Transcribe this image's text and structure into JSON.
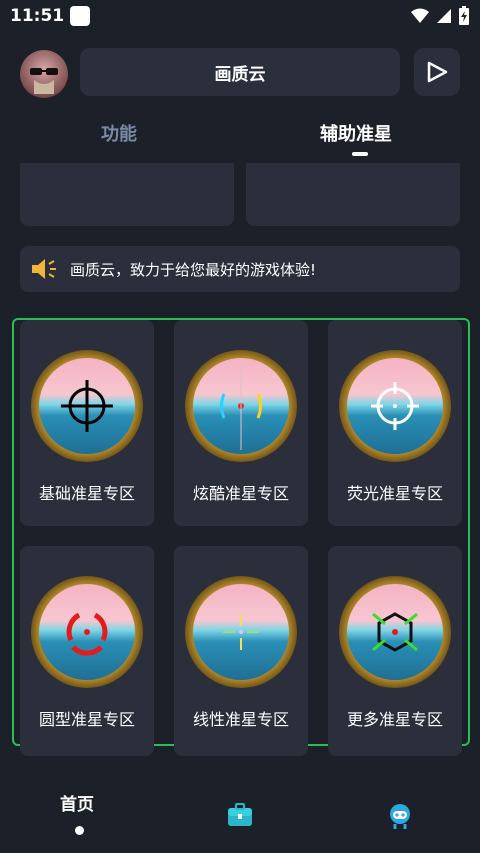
{
  "status": {
    "time": "11:51"
  },
  "header": {
    "title": "画质云"
  },
  "tabs": [
    {
      "label": "功能"
    },
    {
      "label": "辅助准星"
    }
  ],
  "notice": {
    "text": "画质云，致力于给您最好的游戏体验!"
  },
  "cards": [
    {
      "label": "基础准星专区"
    },
    {
      "label": "炫酷准星专区"
    },
    {
      "label": "荧光准星专区"
    },
    {
      "label": "圆型准星专区"
    },
    {
      "label": "线性准星专区"
    },
    {
      "label": "更多准星专区"
    }
  ],
  "bottom_nav": [
    {
      "label": "首页"
    },
    {
      "label": ""
    },
    {
      "label": ""
    }
  ],
  "colors": {
    "bg": "#1c2029",
    "card": "#2a2f3b",
    "accent_green": "#2dbd55",
    "tab_inactive": "#7a8aa6"
  }
}
